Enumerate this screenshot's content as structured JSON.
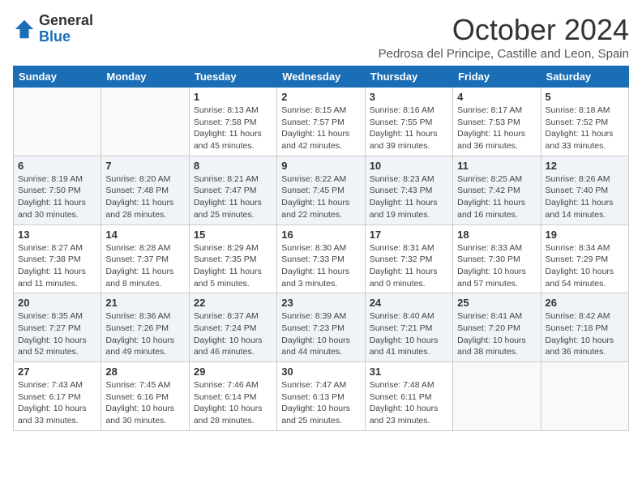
{
  "logo": {
    "general": "General",
    "blue": "Blue"
  },
  "title": "October 2024",
  "subtitle": "Pedrosa del Principe, Castille and Leon, Spain",
  "days": [
    "Sunday",
    "Monday",
    "Tuesday",
    "Wednesday",
    "Thursday",
    "Friday",
    "Saturday"
  ],
  "weeks": [
    [
      {
        "day": "",
        "sunrise": "",
        "sunset": "",
        "daylight": ""
      },
      {
        "day": "",
        "sunrise": "",
        "sunset": "",
        "daylight": ""
      },
      {
        "day": "1",
        "sunrise": "Sunrise: 8:13 AM",
        "sunset": "Sunset: 7:58 PM",
        "daylight": "Daylight: 11 hours and 45 minutes."
      },
      {
        "day": "2",
        "sunrise": "Sunrise: 8:15 AM",
        "sunset": "Sunset: 7:57 PM",
        "daylight": "Daylight: 11 hours and 42 minutes."
      },
      {
        "day": "3",
        "sunrise": "Sunrise: 8:16 AM",
        "sunset": "Sunset: 7:55 PM",
        "daylight": "Daylight: 11 hours and 39 minutes."
      },
      {
        "day": "4",
        "sunrise": "Sunrise: 8:17 AM",
        "sunset": "Sunset: 7:53 PM",
        "daylight": "Daylight: 11 hours and 36 minutes."
      },
      {
        "day": "5",
        "sunrise": "Sunrise: 8:18 AM",
        "sunset": "Sunset: 7:52 PM",
        "daylight": "Daylight: 11 hours and 33 minutes."
      }
    ],
    [
      {
        "day": "6",
        "sunrise": "Sunrise: 8:19 AM",
        "sunset": "Sunset: 7:50 PM",
        "daylight": "Daylight: 11 hours and 30 minutes."
      },
      {
        "day": "7",
        "sunrise": "Sunrise: 8:20 AM",
        "sunset": "Sunset: 7:48 PM",
        "daylight": "Daylight: 11 hours and 28 minutes."
      },
      {
        "day": "8",
        "sunrise": "Sunrise: 8:21 AM",
        "sunset": "Sunset: 7:47 PM",
        "daylight": "Daylight: 11 hours and 25 minutes."
      },
      {
        "day": "9",
        "sunrise": "Sunrise: 8:22 AM",
        "sunset": "Sunset: 7:45 PM",
        "daylight": "Daylight: 11 hours and 22 minutes."
      },
      {
        "day": "10",
        "sunrise": "Sunrise: 8:23 AM",
        "sunset": "Sunset: 7:43 PM",
        "daylight": "Daylight: 11 hours and 19 minutes."
      },
      {
        "day": "11",
        "sunrise": "Sunrise: 8:25 AM",
        "sunset": "Sunset: 7:42 PM",
        "daylight": "Daylight: 11 hours and 16 minutes."
      },
      {
        "day": "12",
        "sunrise": "Sunrise: 8:26 AM",
        "sunset": "Sunset: 7:40 PM",
        "daylight": "Daylight: 11 hours and 14 minutes."
      }
    ],
    [
      {
        "day": "13",
        "sunrise": "Sunrise: 8:27 AM",
        "sunset": "Sunset: 7:38 PM",
        "daylight": "Daylight: 11 hours and 11 minutes."
      },
      {
        "day": "14",
        "sunrise": "Sunrise: 8:28 AM",
        "sunset": "Sunset: 7:37 PM",
        "daylight": "Daylight: 11 hours and 8 minutes."
      },
      {
        "day": "15",
        "sunrise": "Sunrise: 8:29 AM",
        "sunset": "Sunset: 7:35 PM",
        "daylight": "Daylight: 11 hours and 5 minutes."
      },
      {
        "day": "16",
        "sunrise": "Sunrise: 8:30 AM",
        "sunset": "Sunset: 7:33 PM",
        "daylight": "Daylight: 11 hours and 3 minutes."
      },
      {
        "day": "17",
        "sunrise": "Sunrise: 8:31 AM",
        "sunset": "Sunset: 7:32 PM",
        "daylight": "Daylight: 11 hours and 0 minutes."
      },
      {
        "day": "18",
        "sunrise": "Sunrise: 8:33 AM",
        "sunset": "Sunset: 7:30 PM",
        "daylight": "Daylight: 10 hours and 57 minutes."
      },
      {
        "day": "19",
        "sunrise": "Sunrise: 8:34 AM",
        "sunset": "Sunset: 7:29 PM",
        "daylight": "Daylight: 10 hours and 54 minutes."
      }
    ],
    [
      {
        "day": "20",
        "sunrise": "Sunrise: 8:35 AM",
        "sunset": "Sunset: 7:27 PM",
        "daylight": "Daylight: 10 hours and 52 minutes."
      },
      {
        "day": "21",
        "sunrise": "Sunrise: 8:36 AM",
        "sunset": "Sunset: 7:26 PM",
        "daylight": "Daylight: 10 hours and 49 minutes."
      },
      {
        "day": "22",
        "sunrise": "Sunrise: 8:37 AM",
        "sunset": "Sunset: 7:24 PM",
        "daylight": "Daylight: 10 hours and 46 minutes."
      },
      {
        "day": "23",
        "sunrise": "Sunrise: 8:39 AM",
        "sunset": "Sunset: 7:23 PM",
        "daylight": "Daylight: 10 hours and 44 minutes."
      },
      {
        "day": "24",
        "sunrise": "Sunrise: 8:40 AM",
        "sunset": "Sunset: 7:21 PM",
        "daylight": "Daylight: 10 hours and 41 minutes."
      },
      {
        "day": "25",
        "sunrise": "Sunrise: 8:41 AM",
        "sunset": "Sunset: 7:20 PM",
        "daylight": "Daylight: 10 hours and 38 minutes."
      },
      {
        "day": "26",
        "sunrise": "Sunrise: 8:42 AM",
        "sunset": "Sunset: 7:18 PM",
        "daylight": "Daylight: 10 hours and 36 minutes."
      }
    ],
    [
      {
        "day": "27",
        "sunrise": "Sunrise: 7:43 AM",
        "sunset": "Sunset: 6:17 PM",
        "daylight": "Daylight: 10 hours and 33 minutes."
      },
      {
        "day": "28",
        "sunrise": "Sunrise: 7:45 AM",
        "sunset": "Sunset: 6:16 PM",
        "daylight": "Daylight: 10 hours and 30 minutes."
      },
      {
        "day": "29",
        "sunrise": "Sunrise: 7:46 AM",
        "sunset": "Sunset: 6:14 PM",
        "daylight": "Daylight: 10 hours and 28 minutes."
      },
      {
        "day": "30",
        "sunrise": "Sunrise: 7:47 AM",
        "sunset": "Sunset: 6:13 PM",
        "daylight": "Daylight: 10 hours and 25 minutes."
      },
      {
        "day": "31",
        "sunrise": "Sunrise: 7:48 AM",
        "sunset": "Sunset: 6:11 PM",
        "daylight": "Daylight: 10 hours and 23 minutes."
      },
      {
        "day": "",
        "sunrise": "",
        "sunset": "",
        "daylight": ""
      },
      {
        "day": "",
        "sunrise": "",
        "sunset": "",
        "daylight": ""
      }
    ]
  ]
}
